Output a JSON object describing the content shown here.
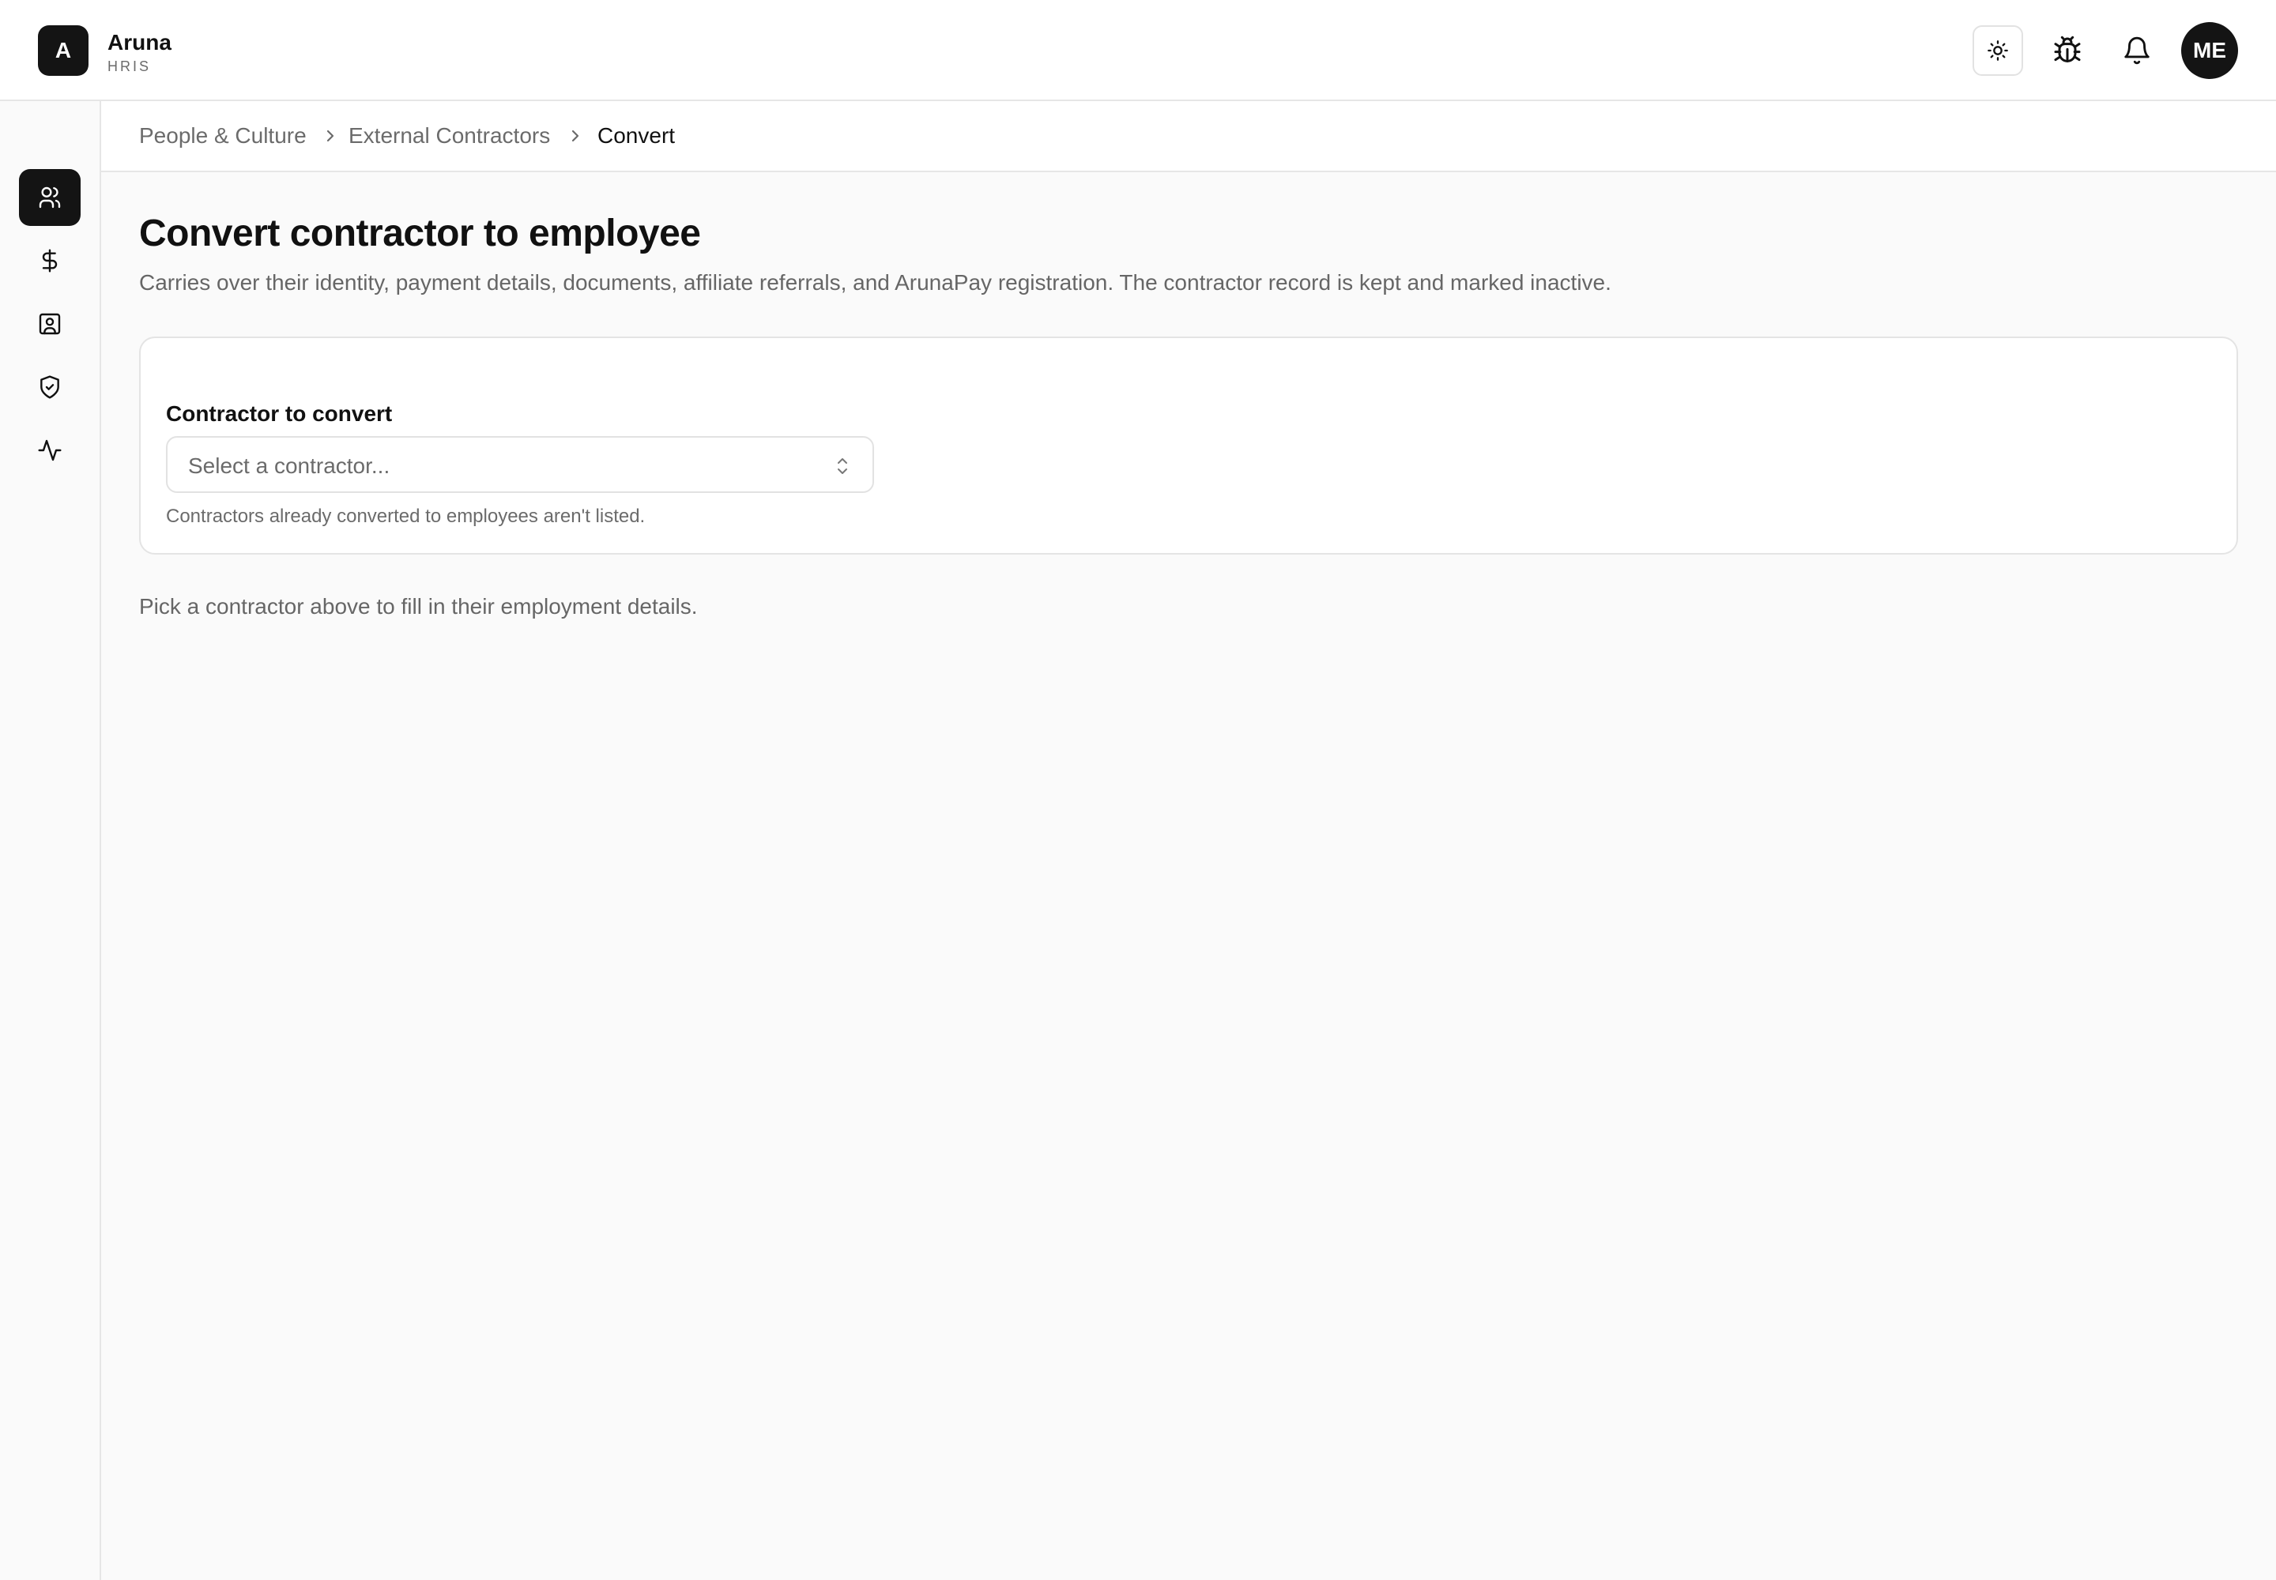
{
  "app": {
    "logo_letter": "A",
    "name": "Aruna",
    "subtitle": "HRIS"
  },
  "header": {
    "icons": [
      "sun-icon",
      "bug-icon",
      "bell-icon"
    ],
    "avatar_initials": "ME"
  },
  "sidebar": {
    "items": [
      {
        "icon": "users-icon",
        "active": true
      },
      {
        "icon": "dollar-icon",
        "active": false
      },
      {
        "icon": "contact-card-icon",
        "active": false
      },
      {
        "icon": "shield-check-icon",
        "active": false
      },
      {
        "icon": "activity-icon",
        "active": false
      }
    ]
  },
  "breadcrumb": [
    "People & Culture",
    "External Contractors",
    "Convert"
  ],
  "page": {
    "title": "Convert contractor to employee",
    "description": "Carries over their identity, payment details, documents, affiliate referrals, and ArunaPay registration. The contractor record is kept and marked inactive."
  },
  "form": {
    "label": "Contractor to convert",
    "placeholder": "Select a contractor...",
    "help": "Contractors already converted to employees aren't listed."
  },
  "hint": "Pick a contractor above to fill in their employment details.",
  "colors": {
    "primary": "#141414",
    "background": "#fafafa",
    "muted_text": "#6b6b6b"
  }
}
